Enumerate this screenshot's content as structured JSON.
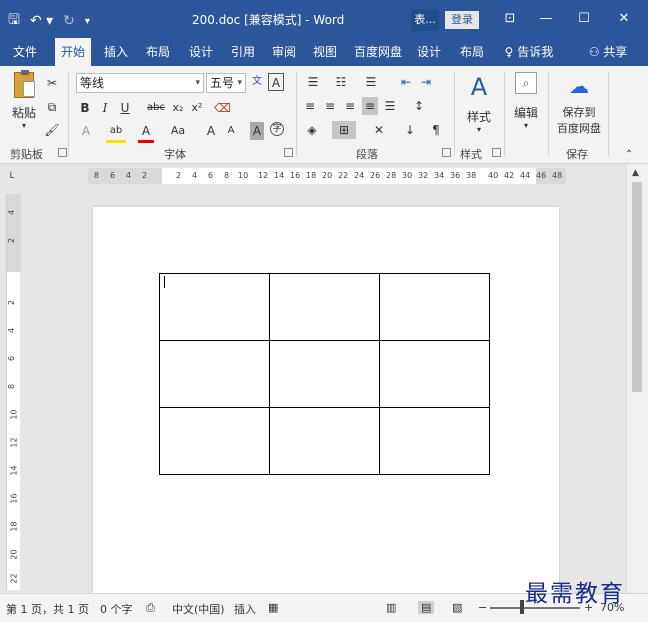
{
  "titlebar": {
    "doc_title": "200.doc [兼容模式]  -  Word",
    "context_tab": "表...",
    "login_label": "登录",
    "minimize_glyph": "—",
    "restore_glyph": "☐",
    "close_glyph": "✕",
    "ribbon_options_glyph": "⊡",
    "save_glyph": "🖫",
    "undo_glyph": "↶ ▾",
    "redo_glyph": "↻",
    "customize_glyph": "▾"
  },
  "menu": {
    "tabs": [
      "文件",
      "开始",
      "插入",
      "布局",
      "设计",
      "引用",
      "审阅",
      "视图",
      "百度网盘",
      "设计",
      "布局"
    ],
    "active_index": 1,
    "tell_me": "告诉我",
    "share": "共享"
  },
  "ribbon": {
    "clipboard": {
      "paste_label": "粘贴",
      "group_label": "剪贴板"
    },
    "font": {
      "font_name": "等线",
      "font_size": "五号",
      "group_label": "字体",
      "bold": "B",
      "italic": "I",
      "underline": "U",
      "strike": "abc",
      "subscript": "x₂",
      "superscript": "x²",
      "grow": "A",
      "shrink": "A",
      "change_case": "Aa"
    },
    "paragraph": {
      "group_label": "段落"
    },
    "styles": {
      "styles_label": "样式",
      "group_label": "样式"
    },
    "editing": {
      "edit_label": "编辑"
    },
    "save": {
      "save_label": "保存到",
      "save_label2": "百度网盘",
      "group_label": "保存"
    }
  },
  "ruler": {
    "corner": "L",
    "h_numbers": [
      "8",
      "6",
      "4",
      "2",
      "2",
      "4",
      "6",
      "8",
      "10",
      "12",
      "14",
      "16",
      "18",
      "20",
      "22",
      "24",
      "26",
      "28",
      "30",
      "32",
      "34",
      "36",
      "38",
      "40",
      "42",
      "44",
      "46",
      "48"
    ],
    "v_numbers": [
      "4",
      "2",
      "2",
      "4",
      "6",
      "8",
      "10",
      "12",
      "14",
      "16",
      "18",
      "20",
      "22"
    ]
  },
  "table": {
    "rows": 3,
    "cols": 3
  },
  "status": {
    "page": "第 1 页，共 1 页",
    "words": "0 个字",
    "language": "中文(中国)",
    "mode": "插入",
    "zoom": "70%"
  },
  "watermark": "最需教育",
  "colors": {
    "ribbon_blue": "#2b579a",
    "ribbon_bg": "#f3f3f3",
    "doc_bg": "#e6e6e6"
  }
}
